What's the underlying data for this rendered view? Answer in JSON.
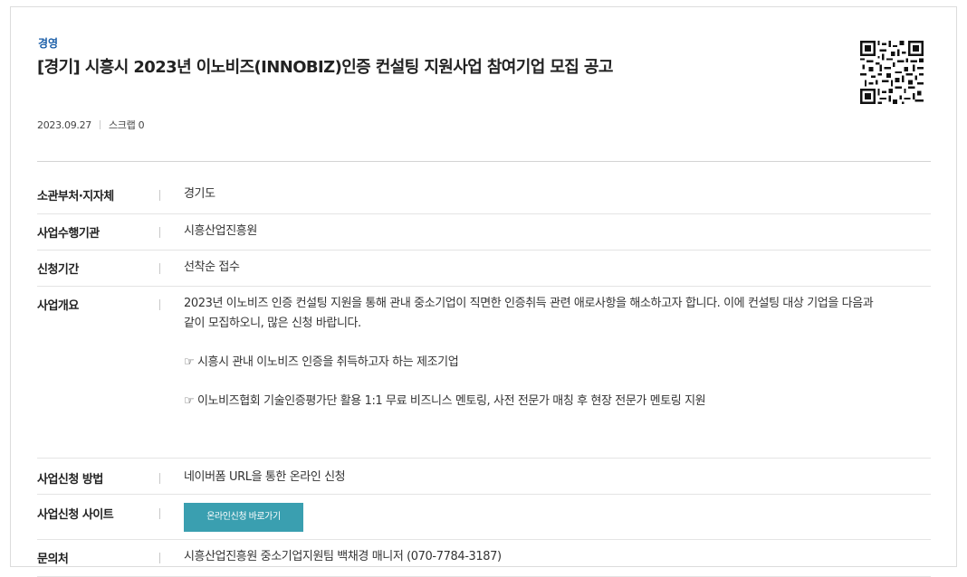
{
  "category": "경영",
  "title": "[경기] 시흥시 2023년 이노비즈(INNOBIZ)인증 컨설팅 지원사업 참여기업 모집 공고",
  "meta": {
    "date": "2023.09.27",
    "scrap": "스크랩 0"
  },
  "qr_icon": "qr-code-icon",
  "rows": [
    {
      "label": "소관부처·지자체",
      "value": "경기도"
    },
    {
      "label": "사업수행기관",
      "value": "시흥산업진흥원"
    },
    {
      "label": "신청기간",
      "value": "선착순 접수"
    },
    {
      "label": "사업개요",
      "lines": [
        "2023년 이노비즈 인증 컨설팅 지원을 통해 관내 중소기업이 직면한 인증취득 관련 애로사항을 해소하고자 합니다. 이에 컨설팅 대상 기업을 다음과",
        "같이 모집하오니, 많은 신청 바랍니다.",
        "☞ 시흥시 관내 이노비즈 인증을 취득하고자 하는 제조기업",
        "☞ 이노비즈협회 기술인증평가단 활용 1:1 무료 비즈니스 멘토링, 사전 전문가 매칭 후 현장 전문가 멘토링 지원"
      ]
    },
    {
      "label": "사업신청 방법",
      "value": "네이버폼 URL을 통한 온라인 신청"
    },
    {
      "label": "사업신청 사이트",
      "button": "온라인신청 바로가기"
    },
    {
      "label": "문의처",
      "value": "시흥산업진흥원 중소기업지원팀 백채경 매니저 (070-7784-3187)"
    }
  ],
  "colors": {
    "category": "#1a5ea8",
    "button": "#3a9fb0"
  }
}
